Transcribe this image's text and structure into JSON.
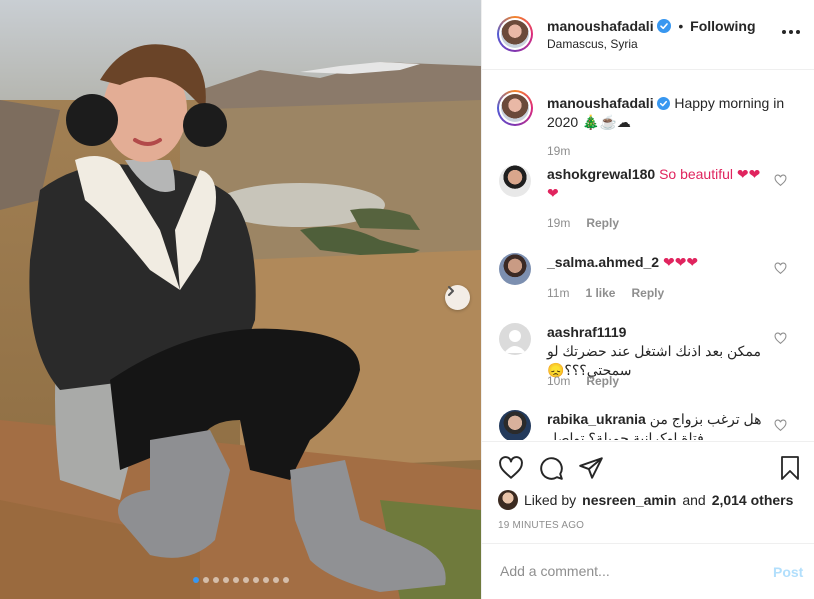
{
  "header": {
    "username": "manoushafadali",
    "separator": "•",
    "follow_status": "Following",
    "location": "Damascus, Syria"
  },
  "caption": {
    "username": "manoushafadali",
    "text": "Happy morning in 2020 🎄☕☁",
    "time": "19m"
  },
  "comments": [
    {
      "username": "ashokgrewal180",
      "text": "So beautiful ❤❤❤",
      "time": "19m",
      "actions": [
        "Reply"
      ]
    },
    {
      "username": "_salma.ahmed_2",
      "text": "❤❤❤",
      "time": "11m",
      "actions": [
        "1 like",
        "Reply"
      ]
    },
    {
      "username": "aashraf1119",
      "text": "ممكن بعد اذنك اشتغل عند حضرتك لو سمحتي؟؟؟😞",
      "time": "10m",
      "actions": [
        "Reply"
      ]
    },
    {
      "username": "rabika_ukrania",
      "text": "هل ترغب بزواج من فتاة اوكرانية جميلة؟ تواصل",
      "time": "",
      "actions": []
    }
  ],
  "likes": {
    "prefix": "Liked by",
    "user": "nesreen_amin",
    "and": "and",
    "others": "2,014 others"
  },
  "posted_time": "19 MINUTES AGO",
  "add_comment": {
    "placeholder": "Add a comment...",
    "post_label": "Post"
  },
  "carousel": {
    "count": 10,
    "active": 0
  },
  "colors": {
    "accent": "#3897f0",
    "heart": "#e0245e",
    "post_disabled": "#b2dffc",
    "muted": "#8e8e8e"
  },
  "icons": [
    "heart-icon",
    "comment-icon",
    "share-icon",
    "bookmark-icon",
    "verified-icon",
    "more-options-icon",
    "chevron-right-icon"
  ]
}
